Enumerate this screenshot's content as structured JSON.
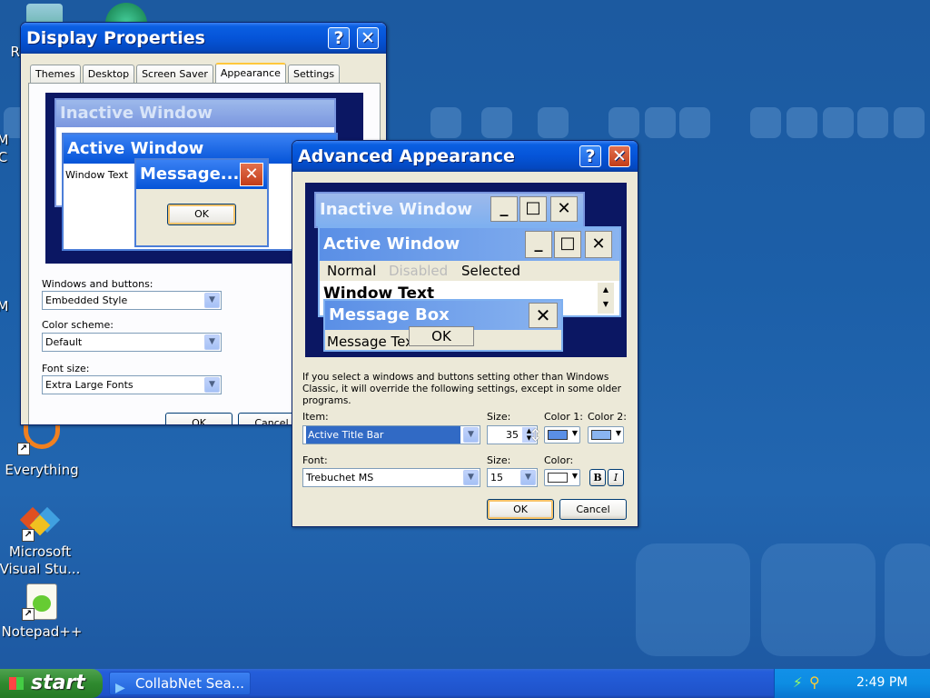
{
  "desktop": {
    "icons": [
      {
        "label": "Re"
      },
      {
        "label": "M"
      },
      {
        "label": "C"
      },
      {
        "label": "M"
      },
      {
        "label": "Everything"
      },
      {
        "label": "Microsoft Visual Stu..."
      },
      {
        "label": "Notepad++"
      }
    ]
  },
  "display_properties": {
    "title": "Display Properties",
    "tabs": [
      "Themes",
      "Desktop",
      "Screen Saver",
      "Appearance",
      "Settings"
    ],
    "selected_tab": "Appearance",
    "preview": {
      "inactive_title": "Inactive Window",
      "active_title": "Active Window",
      "window_text": "Window Text",
      "message_title": "Message...",
      "ok": "OK"
    },
    "windows_buttons_label": "Windows and buttons:",
    "windows_buttons_value": "Embedded Style",
    "color_scheme_label": "Color scheme:",
    "color_scheme_value": "Default",
    "font_size_label": "Font size:",
    "font_size_value": "Extra Large Fonts",
    "ok_label": "OK",
    "cancel_label": "Cancel"
  },
  "advanced": {
    "title": "Advanced Appearance",
    "preview": {
      "inactive_title": "Inactive Window",
      "active_title": "Active Window",
      "menu_normal": "Normal",
      "menu_disabled": "Disabled",
      "menu_selected": "Selected",
      "window_text": "Window Text",
      "message_title": "Message Box",
      "message_text": "Message Text",
      "ok": "OK"
    },
    "info_text": "If you select a windows and buttons setting other than Windows Classic, it will override the following settings, except in some older programs.",
    "item_label": "Item:",
    "item_value": "Active Title Bar",
    "size_label": "Size:",
    "size_value": "35",
    "color1_label": "Color 1:",
    "color2_label": "Color 2:",
    "font_label": "Font:",
    "font_value": "Trebuchet MS",
    "font_size_label": "Size:",
    "font_size_value": "15",
    "font_color_label": "Color:",
    "bold": "B",
    "italic": "I",
    "ok_label": "OK",
    "cancel_label": "Cancel",
    "colors": {
      "color1": "#5a8fe6",
      "color2": "#8ab4f0",
      "font_color": "#ffffff"
    }
  },
  "taskbar": {
    "start_label": "start",
    "task_item": "CollabNet Sea...",
    "clock": "2:49 PM"
  }
}
